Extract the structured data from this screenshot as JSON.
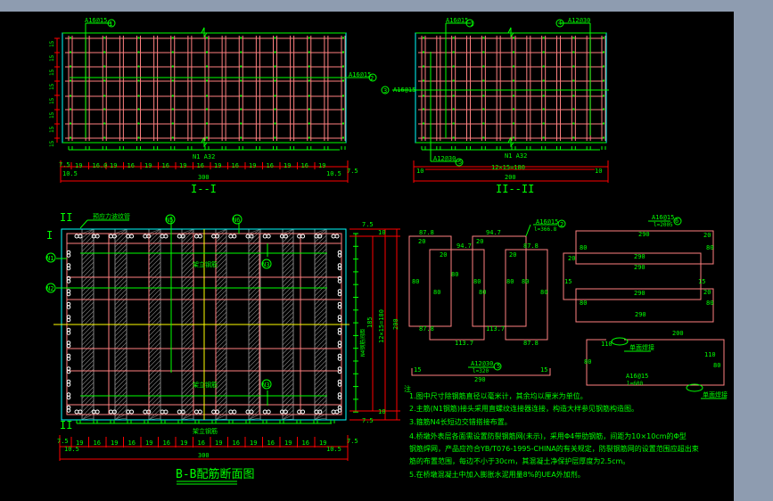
{
  "colors": {
    "background": "#000000",
    "frame": "#8e9cb0",
    "rebar": "#ff8080",
    "dimension": "#ff0000",
    "annotation": "#00ff00",
    "outline": "#00ffff",
    "axis": "#ffff00",
    "duct": "#808080",
    "bar_section": "#ffffff"
  },
  "section_1": {
    "title": "I--I",
    "main_bar": "N1 A32",
    "callout_top": {
      "text": "A16@15",
      "mark": "1"
    },
    "callout_right": {
      "text": "A16@15",
      "mark": "2"
    },
    "left_spacing": [
      "15",
      "15",
      "15",
      "15",
      "15",
      "15",
      "15",
      "15"
    ],
    "dims_row": [
      "19",
      "16.0",
      "19",
      "16",
      "19",
      "16",
      "19",
      "16",
      "19",
      "16",
      "19",
      "16",
      "19",
      "16",
      "19"
    ],
    "dim_edge_left": "7.5",
    "dim_edge_right": "7.5",
    "dim_cover_left": "10.5",
    "dim_cover_right": "10.5",
    "dim_total": "300"
  },
  "section_2": {
    "title": "II--II",
    "main_bar": "N1 A32",
    "callout_top_left": {
      "text": "A16@15",
      "mark": "1"
    },
    "callout_top_right": {
      "text": "A12@30",
      "mark": "4"
    },
    "callout_left": {
      "text": "A16@15",
      "mark": "3"
    },
    "callout_bottom": {
      "text": "A12@30",
      "mark": "5"
    },
    "dim_edge_left": "10",
    "dim_edge_right": "10",
    "dim_spacing": "12×15=180",
    "dim_total": "200"
  },
  "section_bb": {
    "title": "B-B配筋断面图",
    "duct_label": "预应力波纹管",
    "marker_top": "II",
    "marker_bottom": "II",
    "marker_left": "I",
    "marks": {
      "top_a": "N5",
      "top_b": "N6",
      "left_a": "N1",
      "left_b": "N2",
      "inner_top": "N3",
      "inner_bottom": "N3"
    },
    "erection_bar_top": "架立钢筋",
    "erection_bar_bottom": "架立钢筋",
    "erection_bar_below": "架立钢筋",
    "dims_row": [
      "19",
      "16",
      "19",
      "16",
      "19",
      "16",
      "19",
      "16",
      "19",
      "16",
      "19",
      "16",
      "19",
      "16",
      "19"
    ],
    "dim_edge_left": "7.5",
    "dim_edge_right": "7.5",
    "dim_cover_left": "10.5",
    "dim_cover_right": "10.5",
    "dim_total": "300",
    "side_dims": {
      "top_edge": "7.5",
      "top_cover": "10",
      "bottom_edge": "7.5",
      "bottom_cover": "10",
      "spacing": "12×15=180",
      "inner": "185",
      "total": "200",
      "note": "N4钢筋间距"
    }
  },
  "bar_details": {
    "stirrup_callout": {
      "text": "A16@15",
      "mark": "2",
      "length": "l=366.8"
    },
    "stirrup_labels": [
      "87.8",
      "94.7",
      "94.7",
      "87.8",
      "87.8",
      "113.7",
      "113.7",
      "87.8"
    ],
    "stirrup_inner": [
      "20",
      "20",
      "20",
      "20",
      "80",
      "80",
      "80",
      "80",
      "80",
      "80",
      "80",
      "80"
    ],
    "tie_callout": {
      "text": "A16@15",
      "mark": "6",
      "length": "l=2005"
    },
    "tie_labels": [
      "290",
      "290",
      "290",
      "290",
      "290",
      "20",
      "20",
      "20",
      "80",
      "80",
      "80",
      "80",
      "15",
      "15"
    ],
    "straight_callout": {
      "text": "A12@30",
      "mark": "5",
      "length": "l=320"
    },
    "straight_labels": [
      "15",
      "15",
      "290"
    ],
    "hook_bar_labels": [
      "200",
      "110",
      "110",
      "80",
      "80"
    ],
    "hook_callout": {
      "text": "A16@15",
      "length": "l=600"
    },
    "weld_label_a": "单面焊接",
    "weld_label_b": "单面焊接"
  },
  "notes": {
    "heading": "注",
    "items": [
      "1.图中尺寸除钢筋直径以毫米计，其余均以厘米为单位。",
      "2.主筋(N1钢筋)接头采用直螺纹连接器连接，构造大样参见钢筋构造图。",
      "3.箍筋N4长短边交错搭接布置。",
      "4.桥墩外表层各面需设置防裂钢筋网(未示)，采用Φ4带肋钢筋，间距为10×10cm的Φ型",
      "   钢筋焊网，产品应符合YB/T076-1995-CHINA的有关规定，防裂钢筋网的设置范围应超出束",
      "   筋的布置范围，每边不小于30cm，其混凝土净保护层厚度为2.5cm。",
      "5.在桥墩混凝土中加入膨胀水泥用量8%的UEA外加剂。"
    ]
  }
}
